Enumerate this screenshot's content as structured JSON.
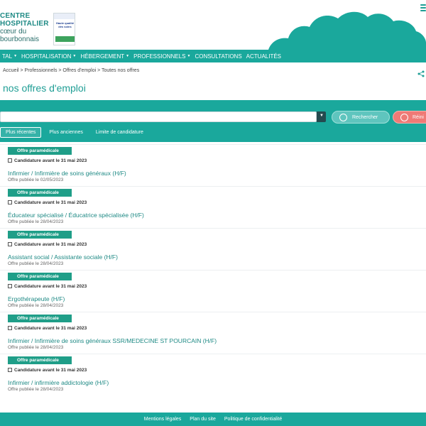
{
  "logo": {
    "line1": "CENTRE",
    "line2": "HOSPITALIER",
    "line3": "cœur du",
    "line4": "bourbonnais",
    "badge_lines": "Haute qualité des soins"
  },
  "nav": {
    "items": [
      {
        "label": "TAL",
        "caret": "▼"
      },
      {
        "label": "HOSPITALISATION",
        "caret": "▼"
      },
      {
        "label": "HÉBERGEMENT",
        "caret": "▼"
      },
      {
        "label": "PROFESSIONNELS",
        "caret": "▼"
      },
      {
        "label": "CONSULTATIONS",
        "caret": ""
      },
      {
        "label": "ACTUALITÉS",
        "caret": ""
      }
    ]
  },
  "breadcrumb": "Accueil > Professionnels > Offres d'emploi > Toutes nos offres",
  "page_title": "nos offres d'emploi",
  "search": {
    "placeholder": "",
    "search_label": "Rechercher",
    "reset_label": "Réini"
  },
  "sort_tabs": [
    {
      "label": "Plus récentes",
      "active": true
    },
    {
      "label": "Plus anciennes",
      "active": false
    },
    {
      "label": "Limite de candidature",
      "active": false
    }
  ],
  "jobs": [
    {
      "category": "Offre paramédicale",
      "deadline": "Candidature avant le 31 mai 2023",
      "title": "Infirmier / Infirmière de soins généraux (H/F)",
      "published": "Offre publiée le 02/05/2023"
    },
    {
      "category": "Offre paramédicale",
      "deadline": "Candidature avant le 31 mai 2023",
      "title": "Éducateur spécialisé / Éducatrice spécialisée (H/F)",
      "published": "Offre publiée le 28/04/2023"
    },
    {
      "category": "Offre paramédicale",
      "deadline": "Candidature avant le 31 mai 2023",
      "title": "Assistant social / Assistante sociale (H/F)",
      "published": "Offre publiée le 28/04/2023"
    },
    {
      "category": "Offre paramédicale",
      "deadline": "Candidature avant le 31 mai 2023",
      "title": "Ergothérapeute (H/F)",
      "published": "Offre publiée le 28/04/2023"
    },
    {
      "category": "Offre paramédicale",
      "deadline": "Candidature avant le 31 mai 2023",
      "title": "Infirmier / Infirmière de soins généraux SSR/MEDECINE ST POURCAIN (H/F)",
      "published": "Offre publiée le 28/04/2023"
    },
    {
      "category": "Offre paramédicale",
      "deadline": "Candidature avant le 31 mai 2023",
      "title": "Infirmier / infirmière addictologie (H/F)",
      "published": "Offre publiée le 28/04/2023"
    }
  ],
  "footer": {
    "links": [
      "Mentions légales",
      "Plan du site",
      "Politique de confidentialité"
    ]
  },
  "colors": {
    "primary": "#1aa89c",
    "ribbon": "#1f9e88",
    "search_button": "#5fc5be",
    "reset_button": "#ef7a76",
    "title_text": "#1f9e95"
  },
  "icons": {
    "menu": "hamburger-icon",
    "share": "share-icon",
    "search": "check-circle-icon",
    "reset": "reset-icon",
    "calendar": "calendar-icon"
  }
}
